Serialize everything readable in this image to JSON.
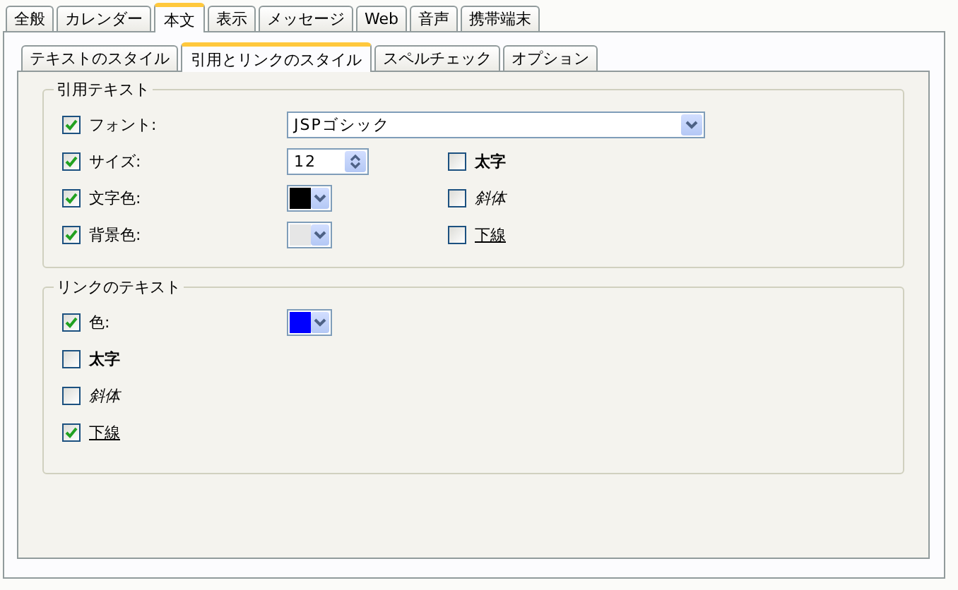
{
  "tabs": [
    {
      "label": "全般",
      "selected": false
    },
    {
      "label": "カレンダー",
      "selected": false
    },
    {
      "label": "本文",
      "selected": true
    },
    {
      "label": "表示",
      "selected": false
    },
    {
      "label": "メッセージ",
      "selected": false
    },
    {
      "label": "Web",
      "selected": false
    },
    {
      "label": "音声",
      "selected": false
    },
    {
      "label": "携帯端末",
      "selected": false
    }
  ],
  "subtabs": [
    {
      "label": "テキストのスタイル",
      "selected": false
    },
    {
      "label": "引用とリンクのスタイル",
      "selected": true
    },
    {
      "label": "スペルチェック",
      "selected": false
    },
    {
      "label": "オプション",
      "selected": false
    }
  ],
  "quote_text": {
    "title": "引用テキスト",
    "rows": [
      {
        "kind": "font",
        "label": "フォント:",
        "checked": true,
        "value": "JSPゴシック"
      },
      {
        "kind": "size",
        "label": "サイズ:",
        "checked": true,
        "value": "12"
      },
      {
        "kind": "color",
        "label": "文字色:",
        "checked": true,
        "color": "#000000"
      },
      {
        "kind": "color",
        "label": "背景色:",
        "checked": true,
        "color": "#e6e6e6"
      }
    ],
    "styles": [
      {
        "kind": "bold",
        "label": "太字",
        "checked": false
      },
      {
        "kind": "italic",
        "label": "斜体",
        "checked": false
      },
      {
        "kind": "underline",
        "label": "下線",
        "checked": false
      }
    ]
  },
  "link_text": {
    "title": "リンクのテキスト",
    "rows": [
      {
        "kind": "color",
        "label": "色:",
        "checked": true,
        "color": "#0000ff"
      },
      {
        "kind": "bold",
        "label": "太字",
        "checked": false
      },
      {
        "kind": "italic",
        "label": "斜体",
        "checked": false
      },
      {
        "kind": "underline",
        "label": "下線",
        "checked": true
      }
    ]
  }
}
